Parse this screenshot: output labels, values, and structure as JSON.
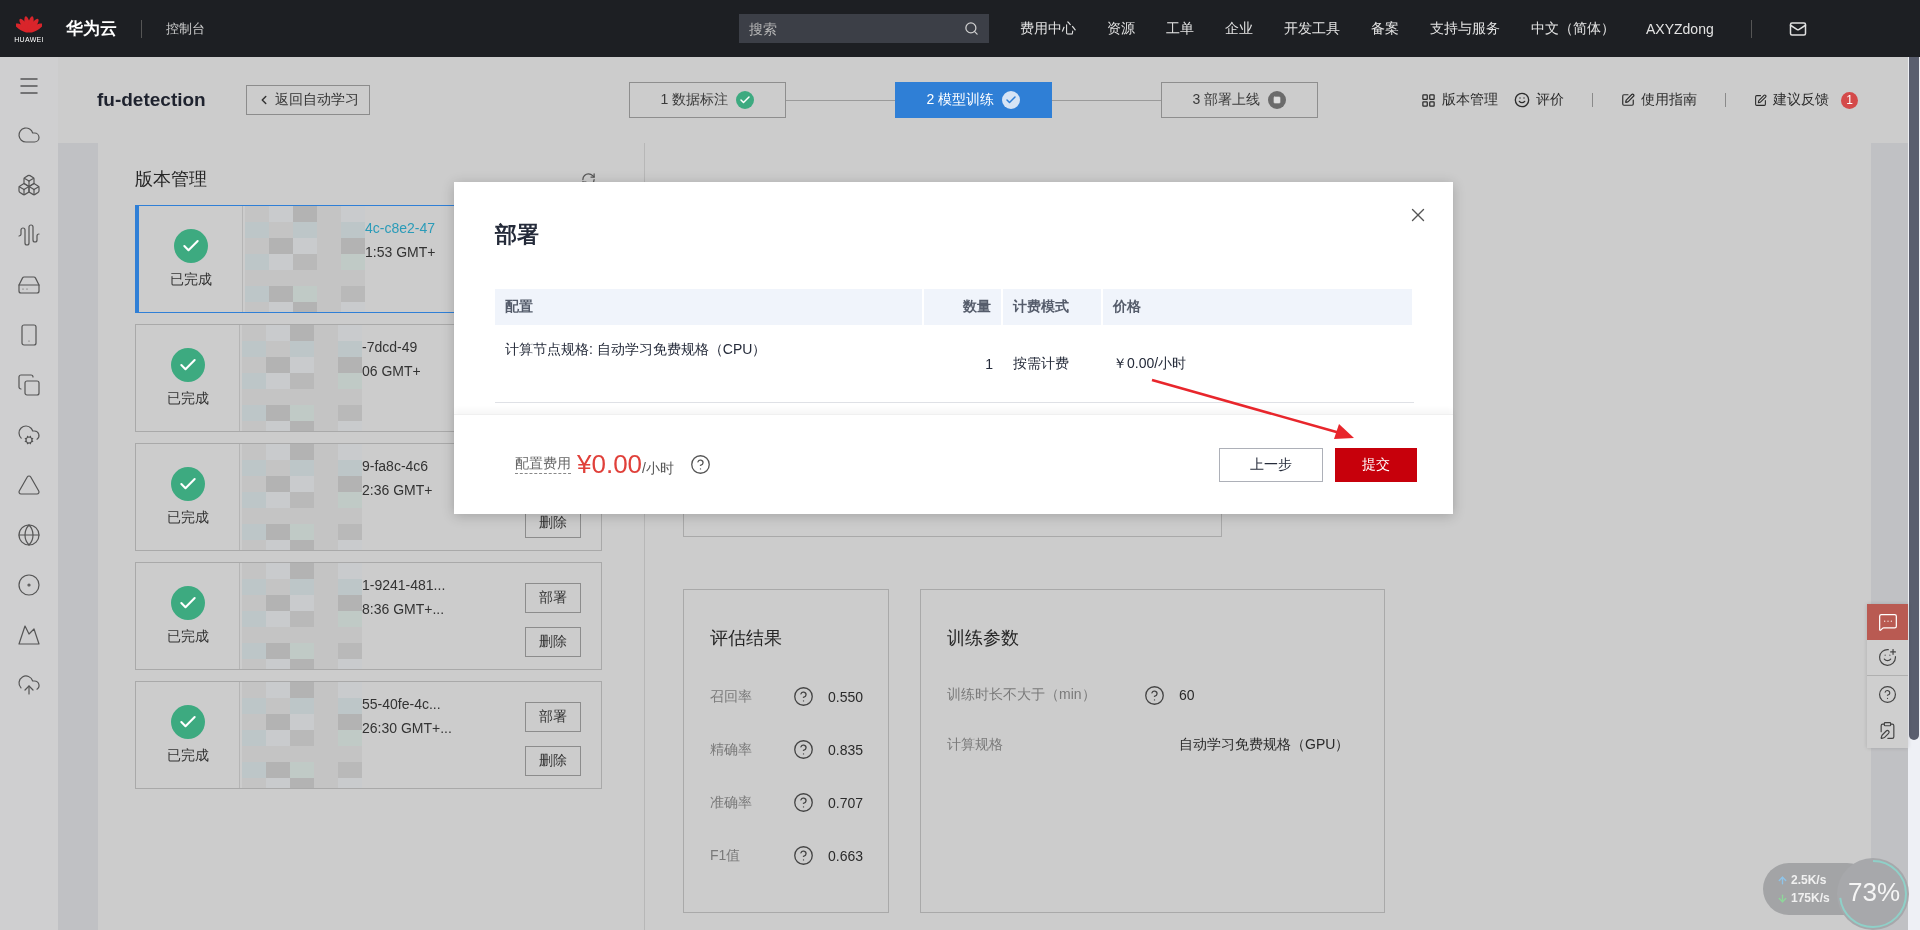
{
  "topbar": {
    "brand_mark": "HUAWEI",
    "brand": "华为云",
    "console": "控制台",
    "search": {
      "placeholder": "搜索"
    },
    "nav": [
      "费用中心",
      "资源",
      "工单",
      "企业",
      "开发工具",
      "备案",
      "支持与服务",
      "中文（简体）",
      "AXYZdong"
    ]
  },
  "header": {
    "title": "fu-detection",
    "back_button": "返回自动学习",
    "steps": [
      {
        "label": "1 数据标注",
        "selected": false,
        "completed": true
      },
      {
        "label": "2 模型训练",
        "selected": true,
        "completed": true
      },
      {
        "label": "3 部署上线",
        "selected": false,
        "completed": false
      }
    ],
    "links": [
      {
        "label": "版本管理",
        "kind": "grid"
      },
      {
        "label": "评价",
        "kind": "rate"
      },
      {
        "label": "使用指南",
        "kind": "guide"
      },
      {
        "label": "建议反馈",
        "kind": "feedback",
        "badge": "1"
      }
    ]
  },
  "versions": {
    "title": "版本管理",
    "cards": [
      {
        "status": "已完成",
        "selected": true,
        "id": "4c-c8e2-47",
        "time": "1:53 GMT+"
      },
      {
        "status": "已完成",
        "selected": false,
        "id": "-7dcd-49",
        "time": "06 GMT+"
      },
      {
        "status": "已完成",
        "selected": false,
        "id": "9-fa8c-4c6",
        "time": "2:36 GMT+",
        "buttons": [
          "删除"
        ]
      },
      {
        "status": "已完成",
        "selected": false,
        "id": "1-9241-481...",
        "time": "8:36 GMT+...",
        "buttons": [
          "部署",
          "删除"
        ]
      },
      {
        "status": "已完成",
        "selected": false,
        "id": "55-40fe-4c...",
        "time": "26:30 GMT+...",
        "buttons": [
          "部署",
          "删除"
        ]
      }
    ]
  },
  "training": {
    "evaluation": {
      "title": "评估结果",
      "metrics": [
        {
          "label": "召回率",
          "value": "0.550"
        },
        {
          "label": "精确率",
          "value": "0.835"
        },
        {
          "label": "准确率",
          "value": "0.707"
        },
        {
          "label": "F1值",
          "value": "0.663"
        }
      ]
    },
    "params": {
      "title": "训练参数",
      "rows": [
        {
          "label": "训练时长不大于（min）",
          "help": true,
          "value": "60"
        },
        {
          "label": "计算规格",
          "help": false,
          "value": "自动学习免费规格（GPU）"
        }
      ]
    }
  },
  "modal": {
    "title": "部署",
    "columns": [
      "配置",
      "数量",
      "计费模式",
      "价格"
    ],
    "rows": [
      [
        "计算节点规格: 自动学习免费规格（CPU）",
        "1",
        "按需计费",
        "￥0.00/小时"
      ]
    ],
    "fee_label": "配置费用",
    "fee": "¥0.00",
    "fee_unit": "/小时",
    "buttons": [
      {
        "label": "上一步",
        "kind": "secondary"
      },
      {
        "label": "提交",
        "kind": "primary"
      }
    ]
  },
  "net_widget": {
    "up": "2.5K/s",
    "down": "175K/s",
    "percent": "73%",
    "level": 0.73
  }
}
